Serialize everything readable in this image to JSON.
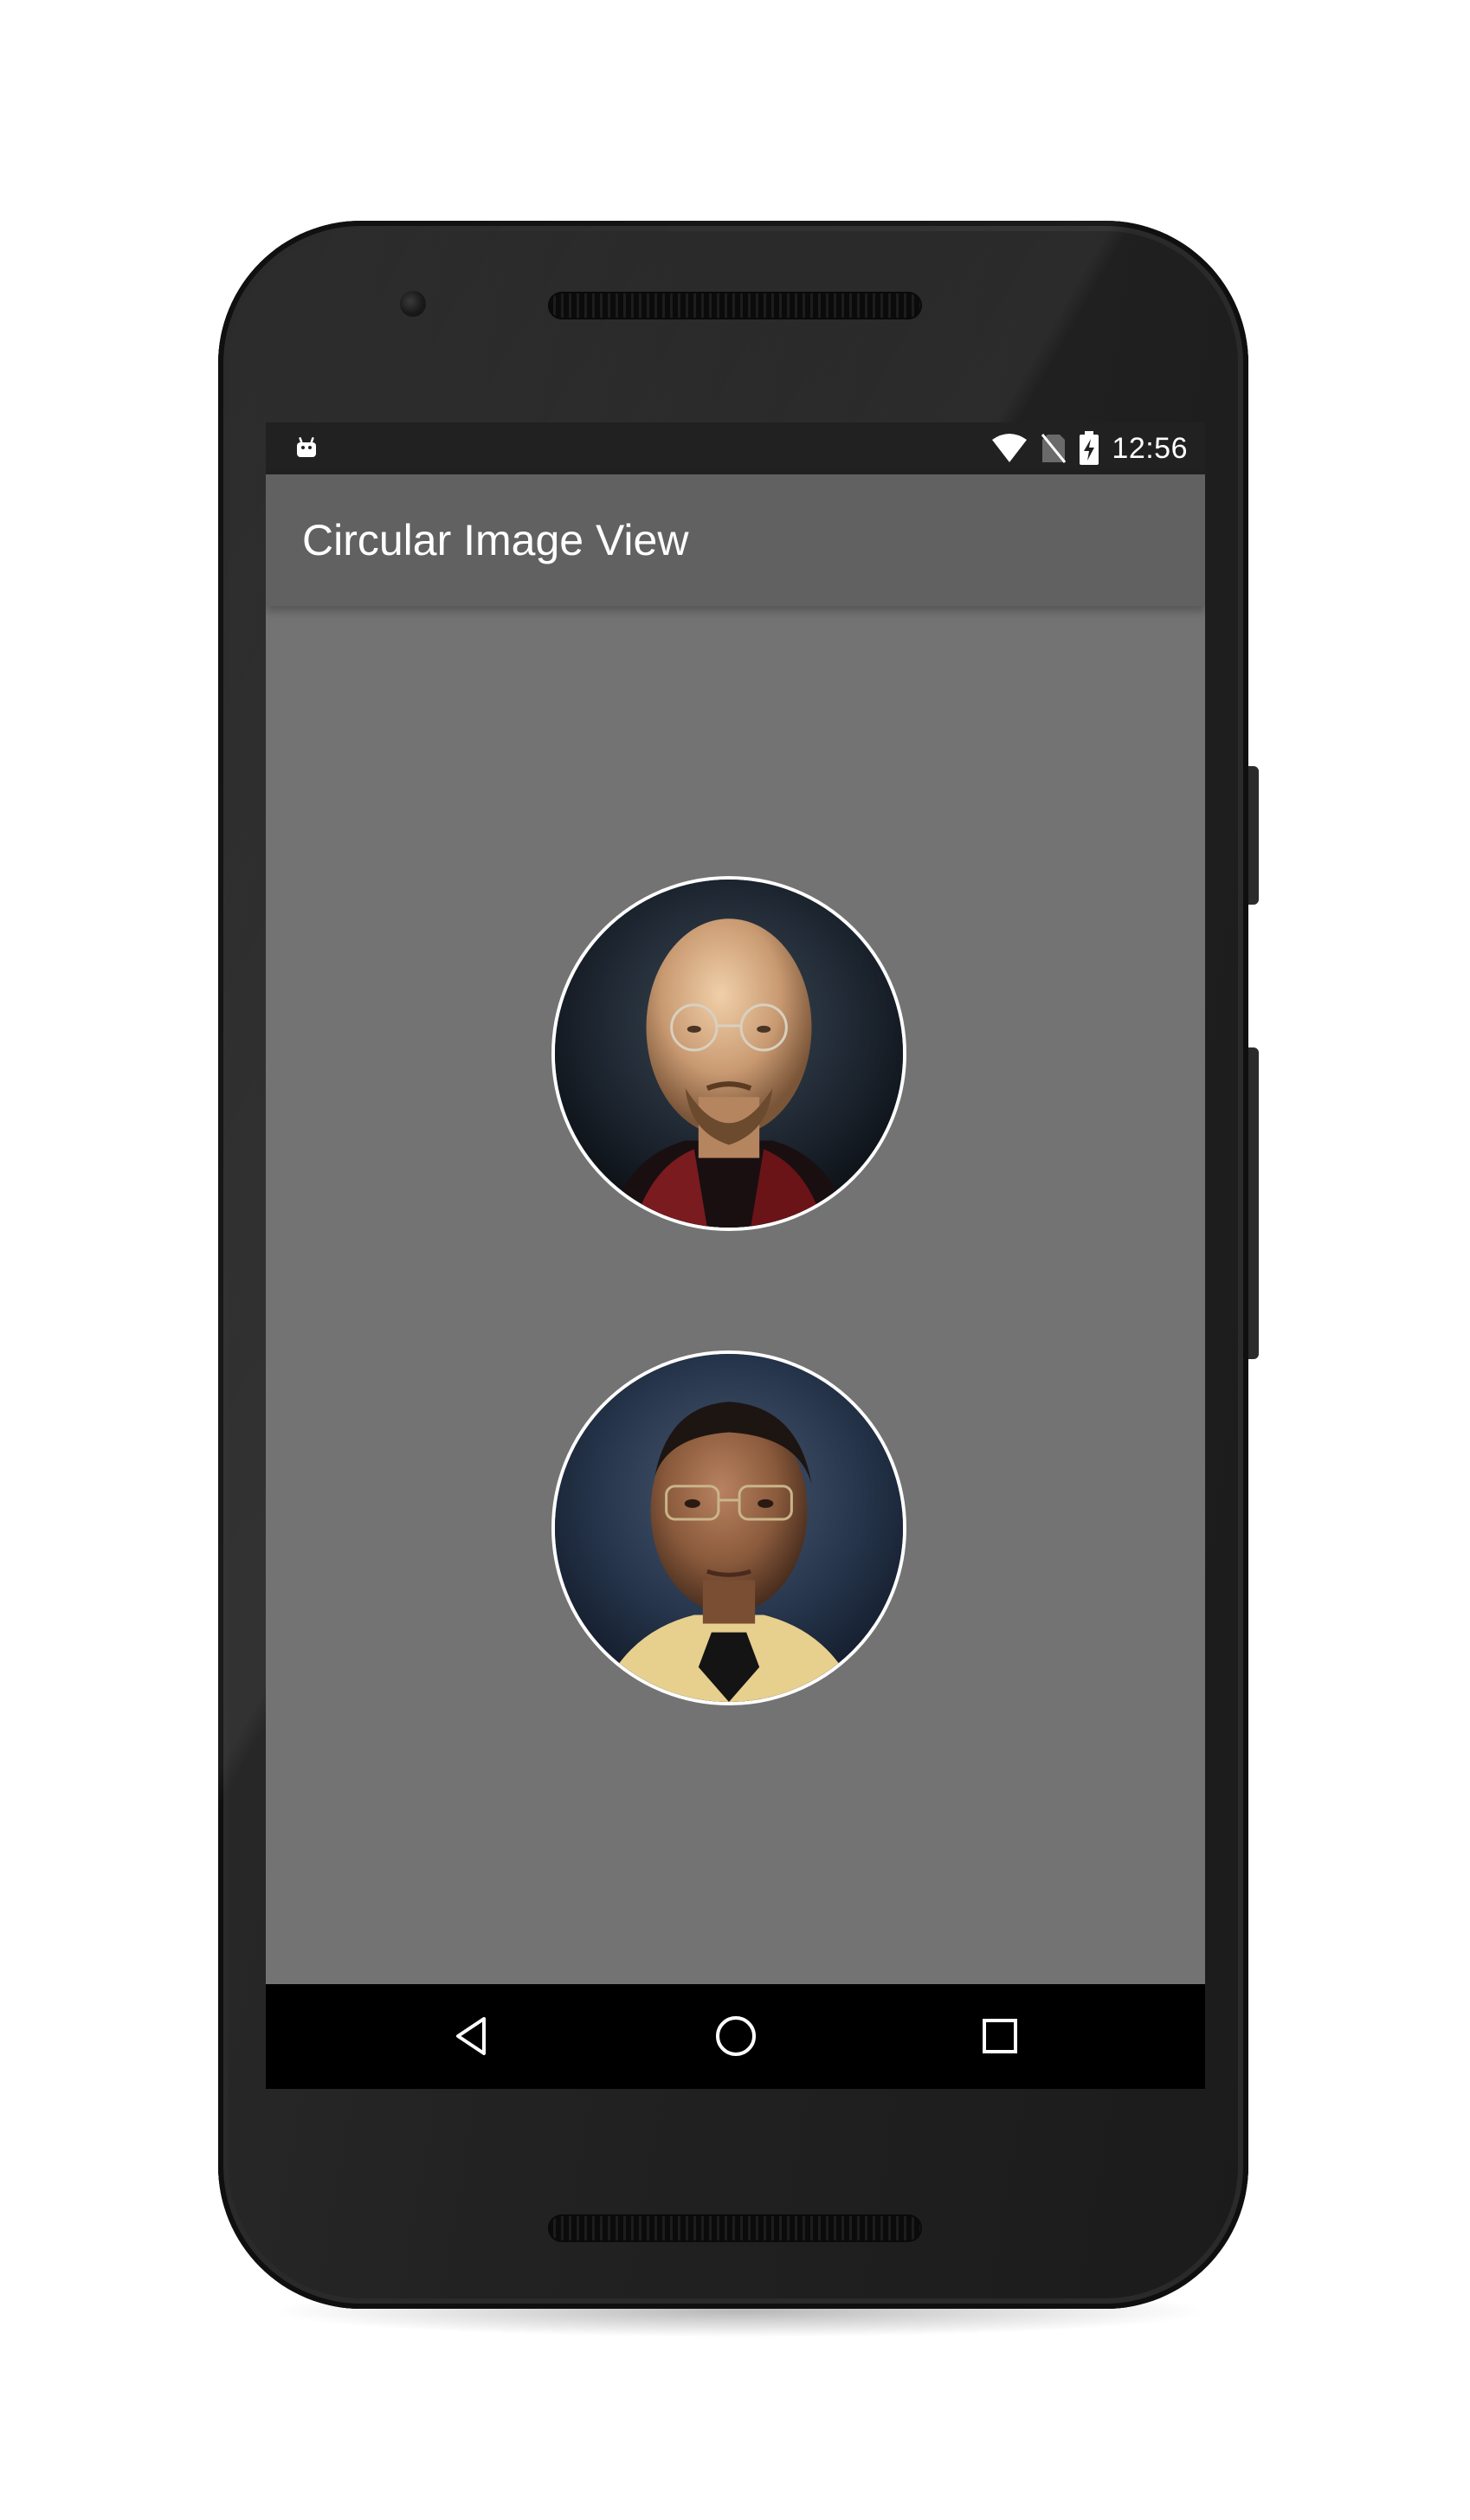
{
  "status_bar": {
    "time": "12:56",
    "icons": [
      "android-debug-icon",
      "wifi-icon",
      "no-sim-icon",
      "battery-charging-icon"
    ]
  },
  "app_bar": {
    "title": "Circular Image View"
  },
  "content": {
    "images": [
      {
        "name": "circular-portrait-1",
        "description_icon": "bald-man-with-glasses-portrait"
      },
      {
        "name": "circular-portrait-2",
        "description_icon": "man-with-glasses-and-tie-portrait"
      }
    ],
    "border_color": "#ffffff"
  },
  "nav_bar": {
    "buttons": [
      "back-icon",
      "home-icon",
      "recents-icon"
    ]
  },
  "colors": {
    "status_bar": "#212121",
    "app_bar": "#616161",
    "content_background": "#737373",
    "nav_bar": "#000000"
  }
}
